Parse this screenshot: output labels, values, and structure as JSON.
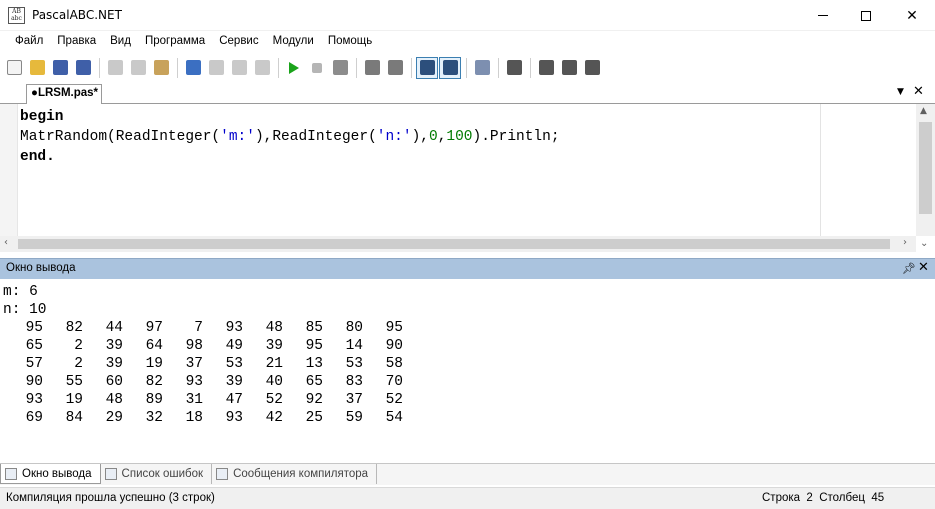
{
  "window": {
    "title": "PascalABC.NET",
    "app_icon_text": "AB\nabc"
  },
  "menu": [
    "Файл",
    "Правка",
    "Вид",
    "Программа",
    "Сервис",
    "Модули",
    "Помощь"
  ],
  "toolbar": {
    "icons": [
      {
        "name": "new-file-icon",
        "color": "#f4f4f4"
      },
      {
        "name": "open-folder-icon",
        "color": "#e6b93c"
      },
      {
        "name": "save-icon",
        "color": "#3f5fa8"
      },
      {
        "name": "save-all-icon",
        "color": "#3f5fa8"
      },
      {
        "name": "sep"
      },
      {
        "name": "cut-icon",
        "color": "#c9c9c9"
      },
      {
        "name": "copy-icon",
        "color": "#c9c9c9"
      },
      {
        "name": "paste-icon",
        "color": "#c8a25b"
      },
      {
        "name": "sep"
      },
      {
        "name": "undo-icon",
        "color": "#3b6fc2"
      },
      {
        "name": "redo-icon",
        "color": "#c9c9c9"
      },
      {
        "name": "nav-back-icon",
        "color": "#c9c9c9"
      },
      {
        "name": "nav-forward-icon",
        "color": "#c9c9c9"
      },
      {
        "name": "sep"
      },
      {
        "name": "run-icon",
        "color": "#1aa31a"
      },
      {
        "name": "stop-icon",
        "color": "#b5b5b5"
      },
      {
        "name": "compile-icon",
        "color": "#8c8c8c"
      },
      {
        "name": "sep"
      },
      {
        "name": "comment-icon",
        "color": "#7a7a7a"
      },
      {
        "name": "uncomment-icon",
        "color": "#7a7a7a"
      },
      {
        "name": "sep"
      },
      {
        "name": "output-window-icon",
        "color": "#2c4f7c",
        "active": true
      },
      {
        "name": "text-mode-icon",
        "color": "#2c4f7c",
        "active": true
      },
      {
        "name": "sep"
      },
      {
        "name": "format-icon",
        "color": "#7d8fb0"
      },
      {
        "name": "sep"
      },
      {
        "name": "debug-icon",
        "color": "#555555"
      },
      {
        "name": "sep"
      },
      {
        "name": "step-into-icon",
        "color": "#555555"
      },
      {
        "name": "step-over-icon",
        "color": "#555555"
      },
      {
        "name": "step-out-icon",
        "color": "#555555"
      }
    ]
  },
  "editor": {
    "tab_label": "●LRSM.pas*",
    "lines": [
      [
        {
          "t": "begin",
          "c": "kw"
        }
      ],
      [
        {
          "t": "MatrRandom(ReadInteger(",
          "c": ""
        },
        {
          "t": "'m:'",
          "c": "str"
        },
        {
          "t": "),ReadInteger(",
          "c": ""
        },
        {
          "t": "'n:'",
          "c": "str"
        },
        {
          "t": "),",
          "c": ""
        },
        {
          "t": "0",
          "c": "num"
        },
        {
          "t": ",",
          "c": ""
        },
        {
          "t": "100",
          "c": "num"
        },
        {
          "t": ").Println;",
          "c": ""
        }
      ],
      [
        {
          "t": "end.",
          "c": "kw"
        }
      ]
    ]
  },
  "output_panel": {
    "title": "Окно вывода",
    "prompts": [
      "m: 6",
      "n: 10"
    ],
    "matrix": [
      [
        95,
        82,
        44,
        97,
        7,
        93,
        48,
        85,
        80,
        95
      ],
      [
        65,
        2,
        39,
        64,
        98,
        49,
        39,
        95,
        14,
        90
      ],
      [
        57,
        2,
        39,
        19,
        37,
        53,
        21,
        13,
        53,
        58
      ],
      [
        90,
        55,
        60,
        82,
        93,
        39,
        40,
        65,
        83,
        70
      ],
      [
        93,
        19,
        48,
        89,
        31,
        47,
        52,
        92,
        37,
        52
      ],
      [
        69,
        84,
        29,
        32,
        18,
        93,
        42,
        25,
        59,
        54
      ]
    ]
  },
  "bottom_tabs": [
    {
      "label": "Окно вывода",
      "active": true,
      "icon": "output-window-icon"
    },
    {
      "label": "Список ошибок",
      "active": false,
      "icon": "error-list-icon"
    },
    {
      "label": "Сообщения компилятора",
      "active": false,
      "icon": "compiler-messages-icon"
    }
  ],
  "status": {
    "message": "Компиляция прошла успешно (3 строк)",
    "position": "Строка  2  Столбец  45"
  }
}
